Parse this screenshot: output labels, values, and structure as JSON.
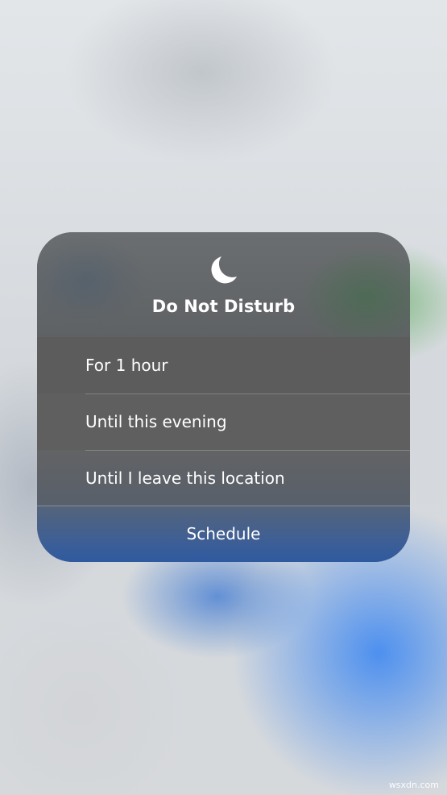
{
  "popup": {
    "icon": "moon-icon",
    "title": "Do Not Disturb",
    "options": [
      {
        "label": "For 1 hour"
      },
      {
        "label": "Until this evening"
      },
      {
        "label": "Until I leave this location"
      }
    ],
    "schedule_label": "Schedule"
  },
  "watermark": "wsxdn.com",
  "colors": {
    "card": "#5f5f60",
    "schedule": "#3f5f94",
    "accent_blue": "#4a8cf0",
    "text": "#ffffff"
  }
}
